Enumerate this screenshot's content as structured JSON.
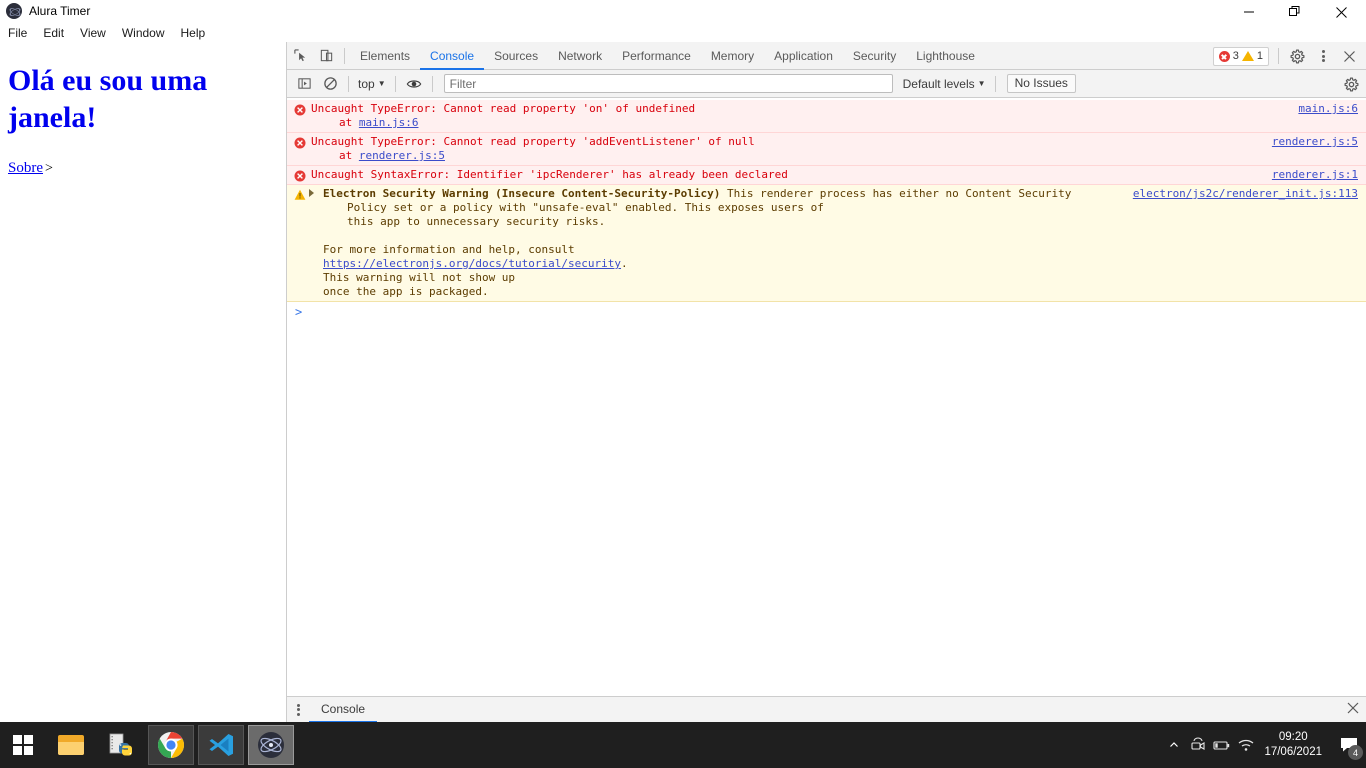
{
  "window": {
    "title": "Alura Timer",
    "app_icon": "electron-atom-icon",
    "controls": {
      "minimize": "minimize-icon",
      "maximize": "maximize-icon",
      "close": "close-icon"
    }
  },
  "menubar": {
    "items": [
      "File",
      "Edit",
      "View",
      "Window",
      "Help"
    ]
  },
  "page": {
    "heading": "Olá eu sou uma janela!",
    "link_label": "Sobre",
    "link_arrow": ">"
  },
  "devtools": {
    "toolbar_icons": [
      "inspect-element-icon",
      "device-toolbar-icon"
    ],
    "tabs": [
      {
        "label": "Elements",
        "active": false
      },
      {
        "label": "Console",
        "active": true
      },
      {
        "label": "Sources",
        "active": false
      },
      {
        "label": "Network",
        "active": false
      },
      {
        "label": "Performance",
        "active": false
      },
      {
        "label": "Memory",
        "active": false
      },
      {
        "label": "Application",
        "active": false
      },
      {
        "label": "Security",
        "active": false
      },
      {
        "label": "Lighthouse",
        "active": false
      }
    ],
    "issues": {
      "error_count": "3",
      "warning_count": "1"
    },
    "more_icon": "kebab-menu-icon",
    "settings_icon": "gear-icon",
    "close_icon": "close-icon",
    "console_toolbar": {
      "sidebar_toggle": "console-sidebar-icon",
      "clear_icon": "clear-console-icon",
      "context": "top",
      "eye_icon": "live-expression-eye-icon",
      "filter_placeholder": "Filter",
      "filter_value": "",
      "levels": "Default levels",
      "issues_button": "No Issues",
      "settings_icon": "gear-icon"
    },
    "messages": [
      {
        "type": "error",
        "text": "Uncaught TypeError: Cannot read property 'on' of undefined",
        "stack_prefix": "at ",
        "stack_link": "main.js:6",
        "source": "main.js:6"
      },
      {
        "type": "error",
        "text": "Uncaught TypeError: Cannot read property 'addEventListener' of null",
        "stack_prefix": "at ",
        "stack_link": "renderer.js:5",
        "source": "renderer.js:5"
      },
      {
        "type": "error",
        "text": "Uncaught SyntaxError: Identifier 'ipcRenderer' has already been declared",
        "stack_prefix": "",
        "stack_link": "",
        "source": "renderer.js:1"
      }
    ],
    "warning": {
      "type": "warning",
      "title": "Electron Security Warning (Insecure Content-Security-Policy)",
      "body_line1": " This renderer process has either no Content Security",
      "body_line2": "Policy set or a policy with \"unsafe-eval\" enabled. This exposes users of",
      "body_line3": "this app to unnecessary security risks.",
      "body_line4": "For more information and help, consult",
      "body_link": "https://electronjs.org/docs/tutorial/security",
      "body_link_suffix": ".",
      "body_line5": "This warning will not show up",
      "body_line6": "once the app is packaged.",
      "source": "electron/js2c/renderer_init.js:113"
    },
    "prompt": ">",
    "drawer": {
      "menu_icon": "kebab-menu-icon",
      "tab": "Console",
      "close_icon": "close-icon"
    }
  },
  "taskbar": {
    "start": "windows-start-icon",
    "apps": [
      {
        "name": "file-explorer-icon",
        "state": "pinned"
      },
      {
        "name": "python-idle-icon",
        "state": "pinned"
      },
      {
        "name": "google-chrome-icon",
        "state": "open"
      },
      {
        "name": "visual-studio-code-icon",
        "state": "open"
      },
      {
        "name": "electron-app-icon",
        "state": "active"
      }
    ],
    "tray": {
      "overflow": "show-hidden-icons-chevron",
      "icons": [
        "camera-privacy-icon",
        "battery-icon",
        "wifi-icon"
      ],
      "time": "09:20",
      "date": "17/06/2021",
      "notification_icon": "action-center-icon",
      "notification_count": "4"
    }
  },
  "colors": {
    "accent_blue": "#1a73e8",
    "link_blue": "#0000ee",
    "error_red": "#d8000c",
    "error_bg": "#fff0f0",
    "warn_bg": "#fffbe5",
    "warn_amber": "#f5b400",
    "taskbar_bg": "#1f1f1f"
  }
}
